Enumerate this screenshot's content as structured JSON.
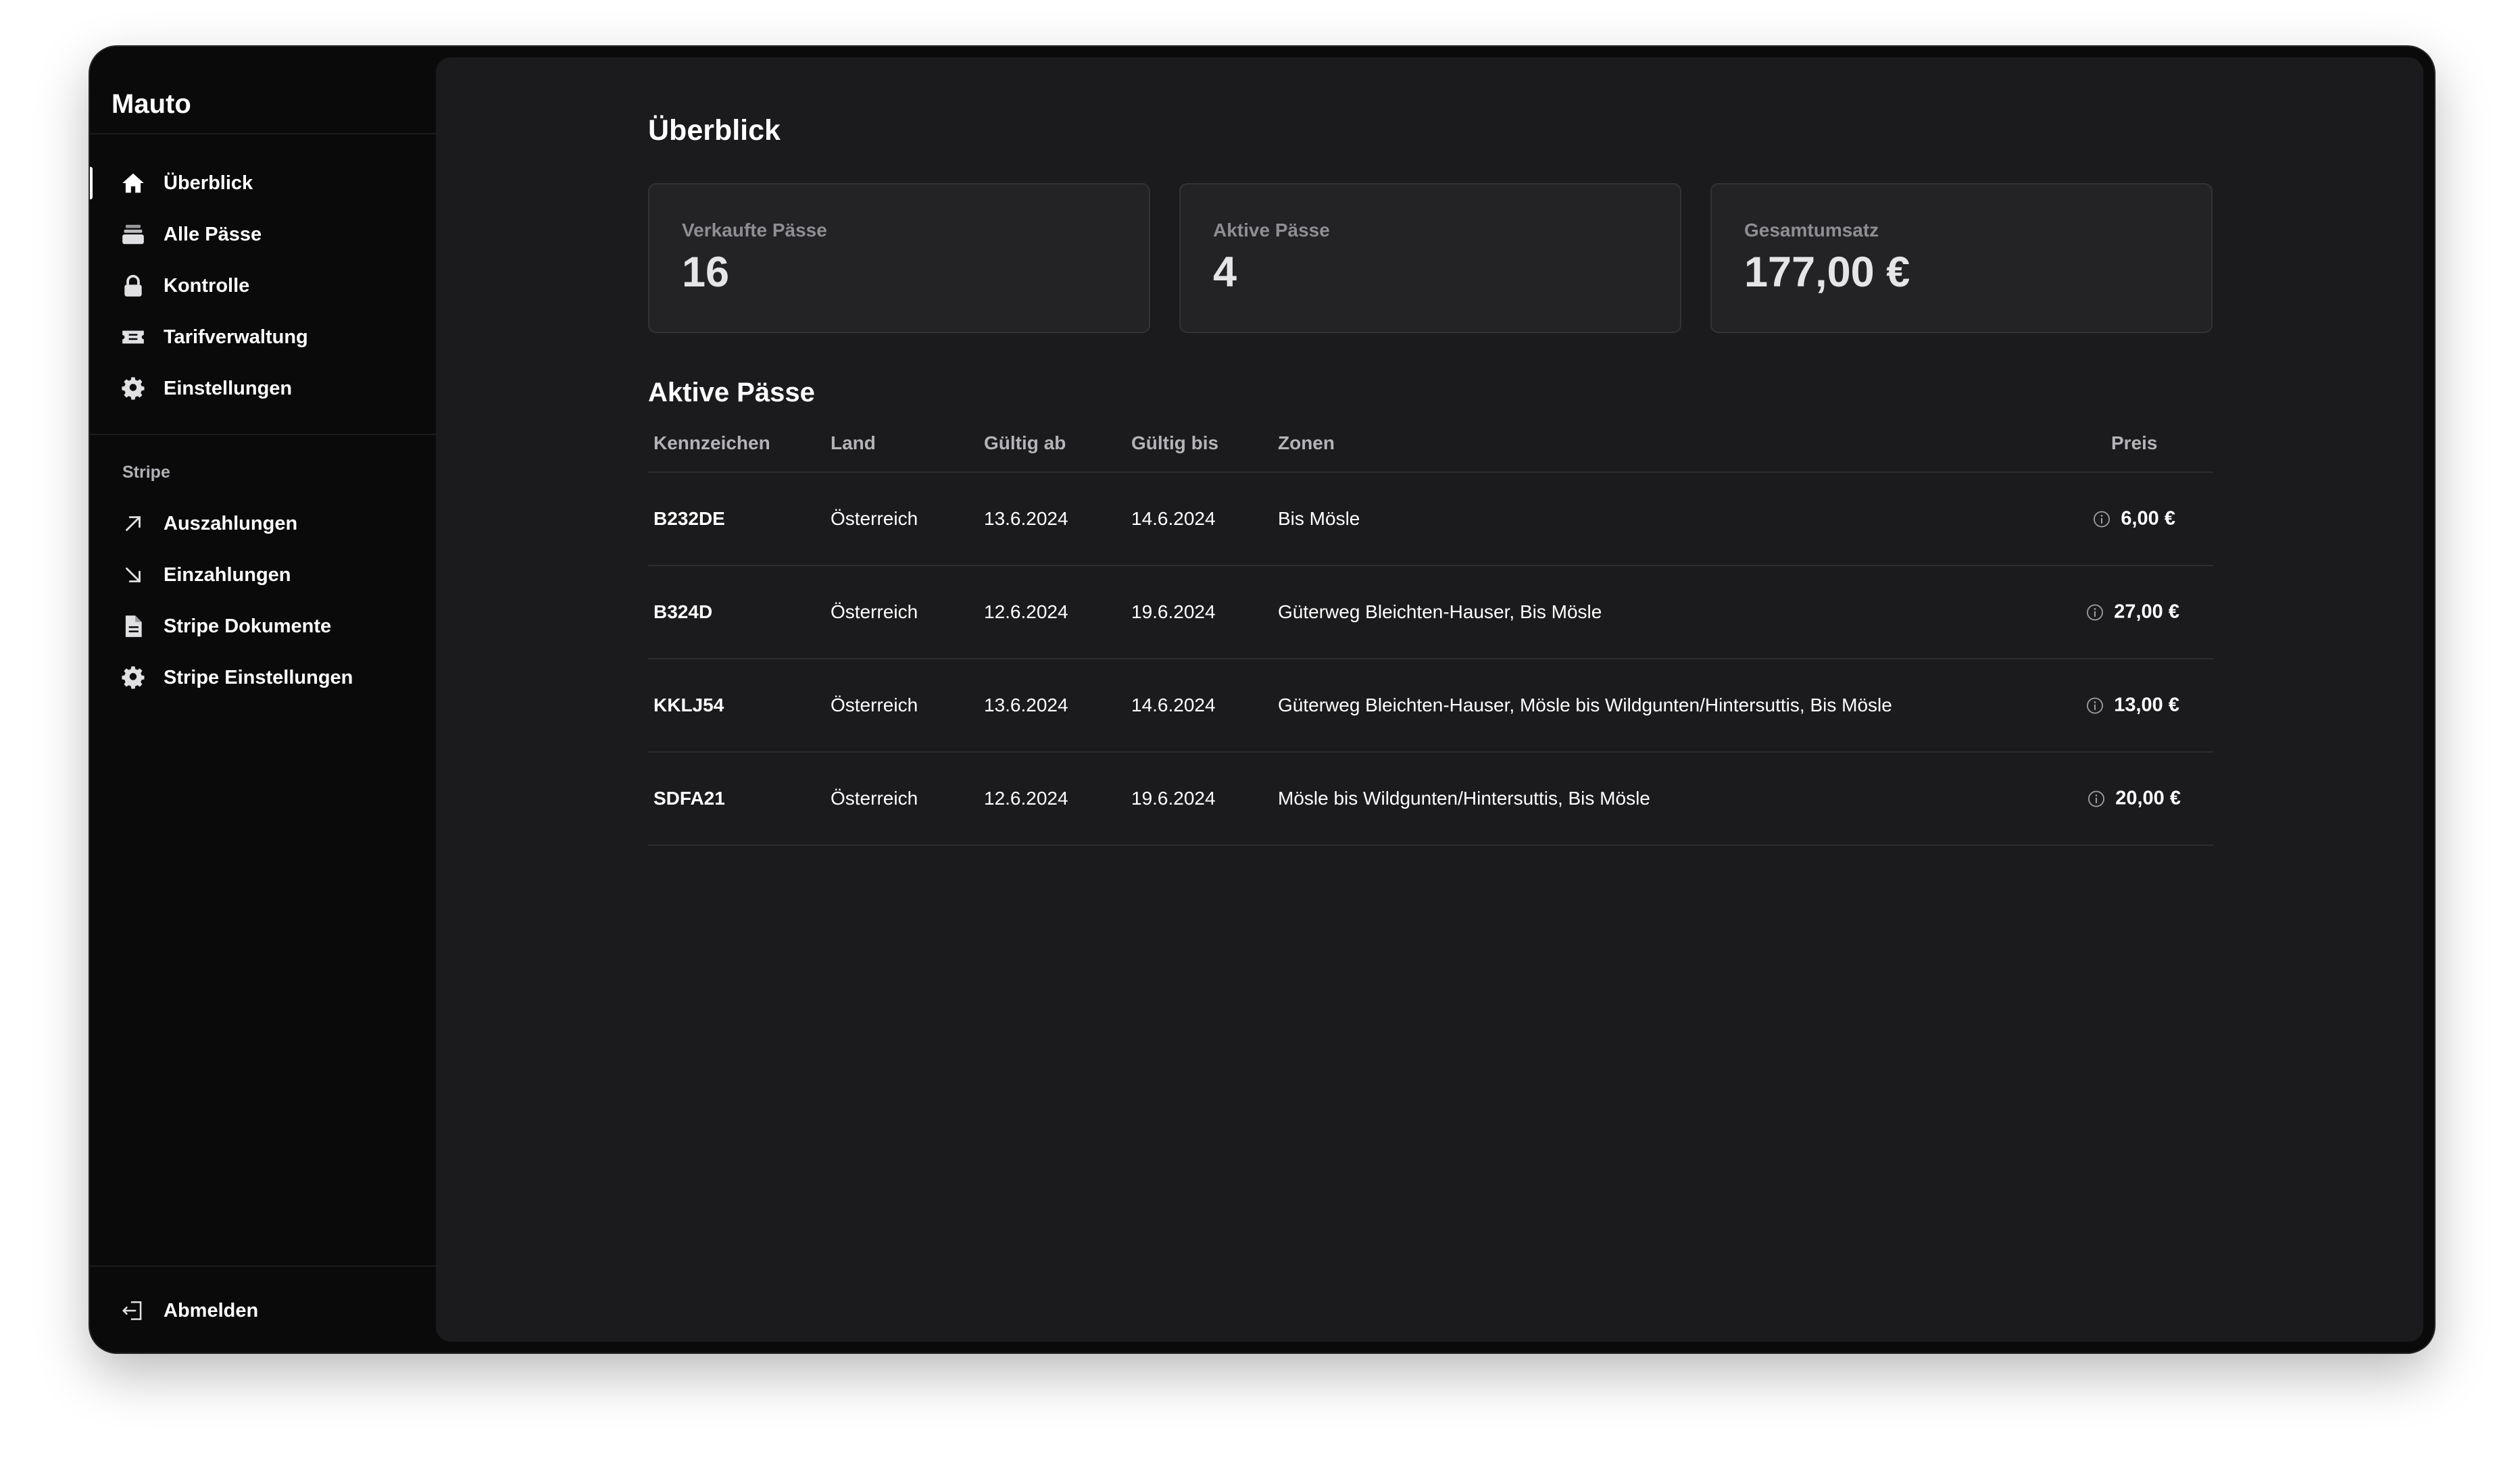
{
  "window": {
    "traffic_lights": [
      "#ff5f57",
      "#febc2e",
      "#28c840"
    ]
  },
  "app": {
    "title": "Mauto"
  },
  "sidebar": {
    "nav": [
      {
        "label": "Überblick",
        "icon": "home-icon",
        "active": true
      },
      {
        "label": "Alle Pässe",
        "icon": "stack-icon"
      },
      {
        "label": "Kontrolle",
        "icon": "lock-icon"
      },
      {
        "label": "Tarifverwaltung",
        "icon": "ticket-icon"
      },
      {
        "label": "Einstellungen",
        "icon": "gear-icon"
      }
    ],
    "stripe_section": {
      "label": "Stripe",
      "items": [
        {
          "label": "Auszahlungen",
          "icon": "arrow-up-right-icon"
        },
        {
          "label": "Einzahlungen",
          "icon": "arrow-down-right-icon"
        },
        {
          "label": "Stripe Dokumente",
          "icon": "document-icon"
        },
        {
          "label": "Stripe Einstellungen",
          "icon": "gear-icon"
        }
      ]
    },
    "logout": {
      "label": "Abmelden",
      "icon": "logout-icon"
    }
  },
  "main": {
    "title": "Überblick",
    "stats": [
      {
        "label": "Verkaufte Pässe",
        "value": "16"
      },
      {
        "label": "Aktive Pässe",
        "value": "4"
      },
      {
        "label": "Gesamtumsatz",
        "value": "177,00 €"
      }
    ],
    "active_passes": {
      "title": "Aktive Pässe",
      "columns": [
        "Kennzeichen",
        "Land",
        "Gültig ab",
        "Gültig bis",
        "Zonen",
        "Preis"
      ],
      "rows": [
        {
          "plate": "B232DE",
          "country": "Österreich",
          "valid_from": "13.6.2024",
          "valid_to": "14.6.2024",
          "zones": "Bis Mösle",
          "price": "6,00 €"
        },
        {
          "plate": "B324D",
          "country": "Österreich",
          "valid_from": "12.6.2024",
          "valid_to": "19.6.2024",
          "zones": "Güterweg Bleichten-Hauser, Bis Mösle",
          "price": "27,00 €"
        },
        {
          "plate": "KKLJ54",
          "country": "Österreich",
          "valid_from": "13.6.2024",
          "valid_to": "14.6.2024",
          "zones": "Güterweg Bleichten-Hauser, Mösle bis Wildgunten/Hintersuttis, Bis Mösle",
          "price": "13,00 €"
        },
        {
          "plate": "SDFA21",
          "country": "Österreich",
          "valid_from": "12.6.2024",
          "valid_to": "19.6.2024",
          "zones": "Mösle bis Wildgunten/Hintersuttis, Bis Mösle",
          "price": "20,00 €"
        }
      ]
    }
  },
  "colors": {
    "window_bg": "#0a0a0a",
    "main_bg": "#1b1b1d",
    "card_bg": "#232325",
    "text_primary": "#ffffff",
    "text_muted": "#8e8e93"
  }
}
